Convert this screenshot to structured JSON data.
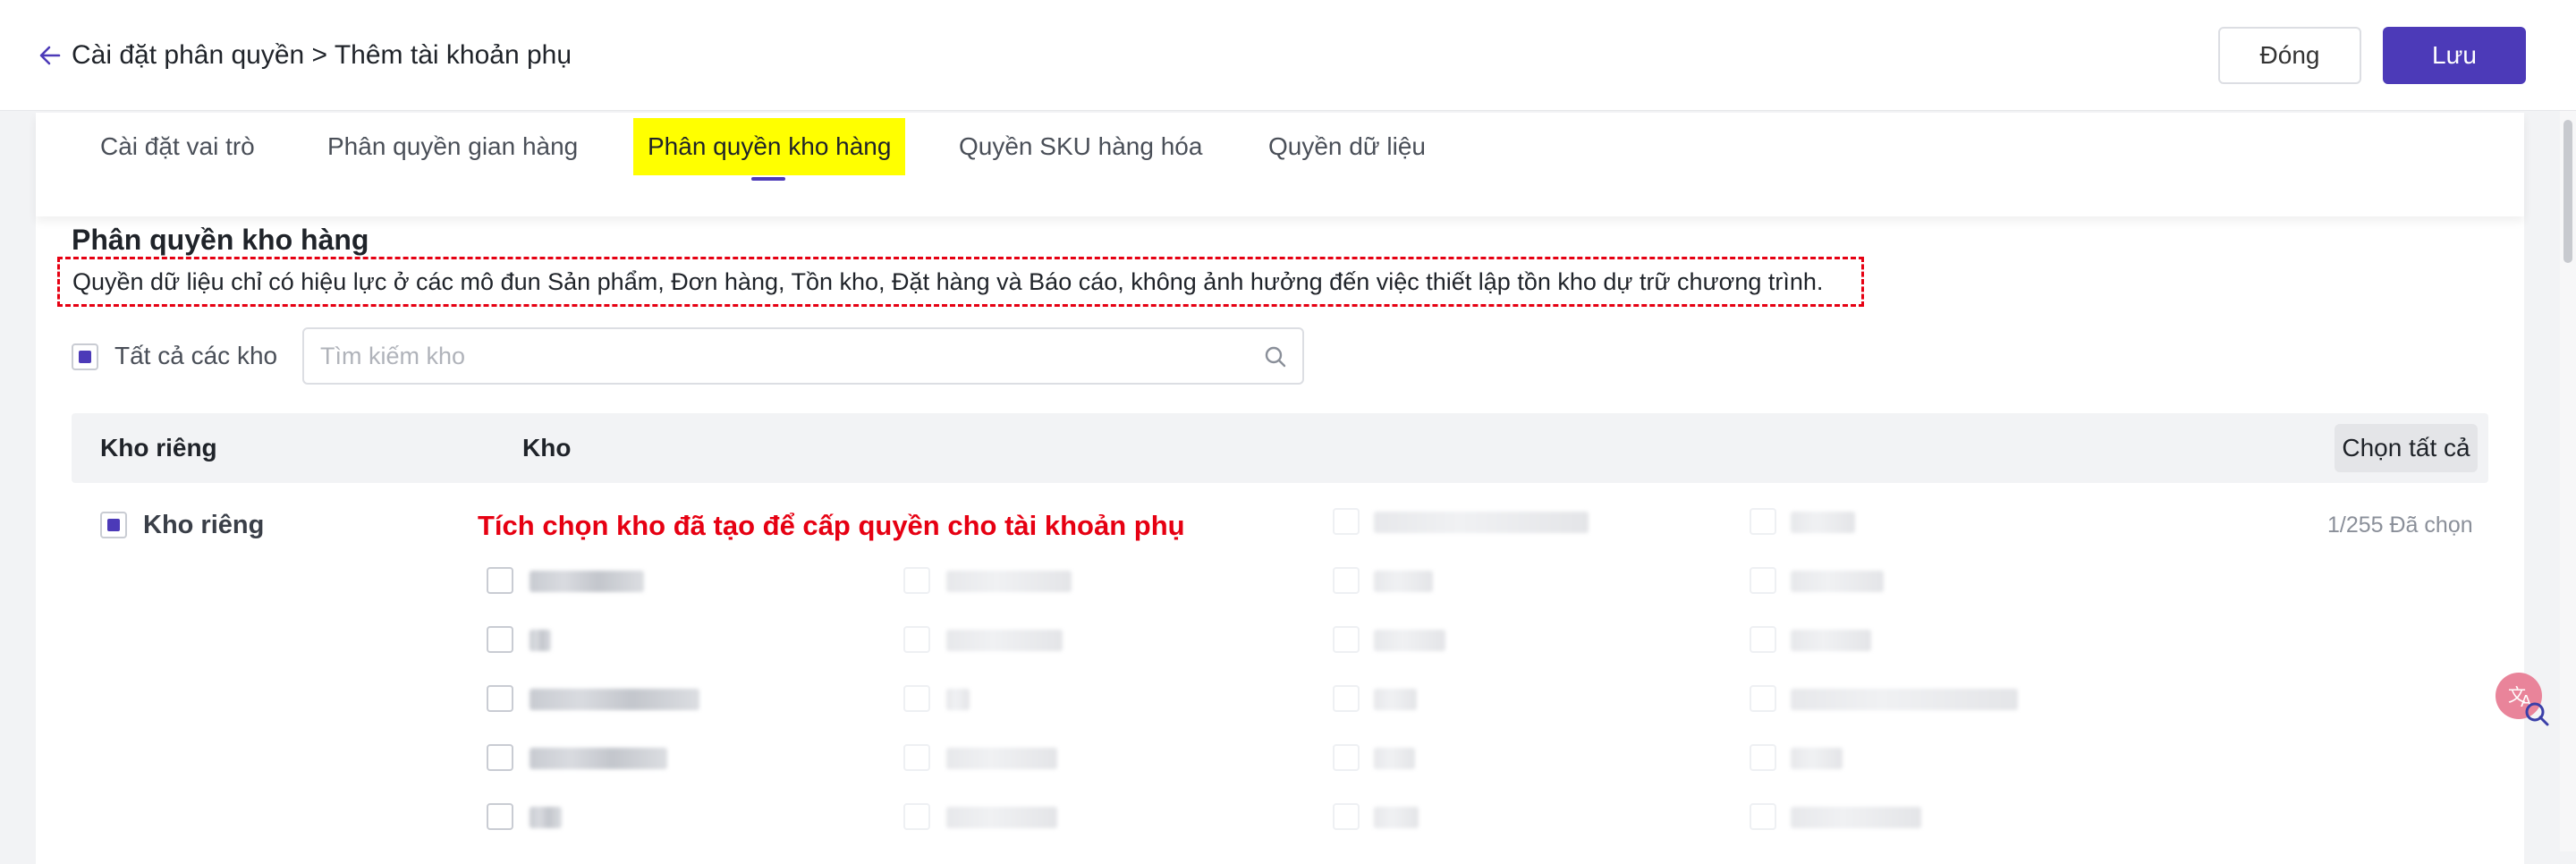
{
  "header": {
    "breadcrumb": "Cài đặt phân quyền > Thêm tài khoản phụ",
    "close_label": "Đóng",
    "save_label": "Lưu"
  },
  "tabs": [
    {
      "label": "Cài đặt vai trò"
    },
    {
      "label": "Phân quyền gian hàng"
    },
    {
      "label": "Phân quyền kho hàng",
      "active": true
    },
    {
      "label": "Quyền SKU hàng hóa"
    },
    {
      "label": "Quyền dữ liệu"
    }
  ],
  "section": {
    "title": "Phân quyền kho hàng",
    "notice": "Quyền dữ liệu chỉ có hiệu lực ở các mô đun Sản phẩm, Đơn hàng, Tồn kho, Đặt hàng và Báo cáo, không ảnh hưởng đến việc thiết lập tồn kho dự trữ chương trình."
  },
  "filter": {
    "all_label": "Tất cả các kho",
    "search_placeholder": "Tìm kiếm kho"
  },
  "table": {
    "col_group": "Kho riêng",
    "col_warehouse": "Kho",
    "select_all_label": "Chọn tất cả",
    "group_label": "Kho riêng",
    "annotation": "Tích chọn kho đã tạo để cấp quyền cho tài khoản phụ",
    "count_text": "1/255 Đã chọn"
  },
  "colors": {
    "accent": "#4c3ab8",
    "annotation_red": "#e60012",
    "highlight_yellow": "#ffff00"
  },
  "icons": {
    "back": "arrow-left-icon",
    "search": "search-icon",
    "tool": "translate-search-icon"
  }
}
